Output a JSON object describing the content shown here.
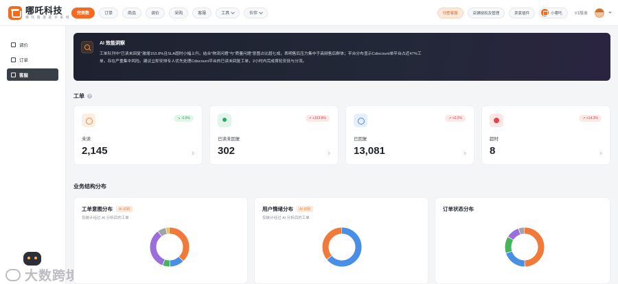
{
  "header": {
    "brand_name": "哪吒科技",
    "brand_sub": "哪 吒 跨 境 助 手 系 统",
    "nav": [
      {
        "label": "完美数",
        "active": true
      },
      {
        "label": "订单",
        "active": false
      },
      {
        "label": "商品",
        "active": false
      },
      {
        "label": "调价",
        "active": false
      },
      {
        "label": "采购",
        "active": false
      },
      {
        "label": "客服",
        "active": false
      },
      {
        "label": "工具",
        "active": false,
        "dropdown": true
      },
      {
        "label": "伙伴",
        "active": false,
        "dropdown": true
      }
    ],
    "right_buttons": [
      "刊登客服",
      "店铺授权及管理",
      "卖家插件"
    ],
    "user_name": "小哪吒",
    "version": "V1版本"
  },
  "sidebar": {
    "items": [
      {
        "label": "调价",
        "icon": "tag-icon",
        "active": false
      },
      {
        "label": "订单",
        "icon": "order-icon",
        "active": false
      },
      {
        "label": "客服",
        "icon": "service-icon",
        "active": true
      }
    ],
    "watermark": "大数跨境"
  },
  "insight": {
    "title": "AI 效能洞察",
    "body": "工单队列中\"已读未回复\"激增153.8%且SLA超时小幅上升。结合\"物流问题\"与\"质量问题\"意图占比超七成，表明售后压力集中于高频售后群体；平台分布显示Cdiscount单平台占近47%工单，存在严重集中风险。建议立即安排专人优先处理Cdiscount平台的已读未回复工单，2小时内完成首轮安抚与分流。"
  },
  "tickets": {
    "section_title": "工单",
    "cards": [
      {
        "label": "未读",
        "value": "2,145",
        "change": "↘ -0.5%",
        "trend": "down",
        "icon": "chat-icon"
      },
      {
        "label": "已读未回复",
        "value": "302",
        "change": "↗ +153.8%",
        "trend": "up",
        "icon": "user-icon"
      },
      {
        "label": "已回复",
        "value": "13,081",
        "change": "↗ +0.2%",
        "trend": "up",
        "icon": "check-icon"
      },
      {
        "label": "超时",
        "value": "8",
        "change": "↗ +14.3%",
        "trend": "up",
        "icon": "alert-icon"
      }
    ]
  },
  "distribution": {
    "section_title": "业务结构分布",
    "cards": [
      {
        "title": "工单意图分布",
        "tag": "AI 识别",
        "desc": "仅统计经过 AI 分析后的工单"
      },
      {
        "title": "用户情绪分布",
        "tag": "AI 识别",
        "desc": "仅统计经过 AI 分析后的工单"
      },
      {
        "title": "订单状态分布",
        "tag": "",
        "desc": ""
      }
    ]
  },
  "chart_data": [
    {
      "type": "pie",
      "title": "工单意图分布",
      "values": [
        38,
        12,
        6,
        34,
        7,
        3
      ],
      "colors": [
        "#f07a3a",
        "#4a8fe6",
        "#46b35d",
        "#9a6fdc",
        "#a0a4ab",
        "#f0c04a"
      ]
    },
    {
      "type": "pie",
      "title": "用户情绪分布",
      "values": [
        64,
        36
      ],
      "colors": [
        "#4a8fe6",
        "#f07a3a"
      ]
    },
    {
      "type": "pie",
      "title": "订单状态分布",
      "values": [
        50,
        20,
        14,
        11,
        5
      ],
      "colors": [
        "#f07a3a",
        "#4a8fe6",
        "#46b35d",
        "#9a6fdc",
        "#a0a4ab"
      ]
    }
  ]
}
